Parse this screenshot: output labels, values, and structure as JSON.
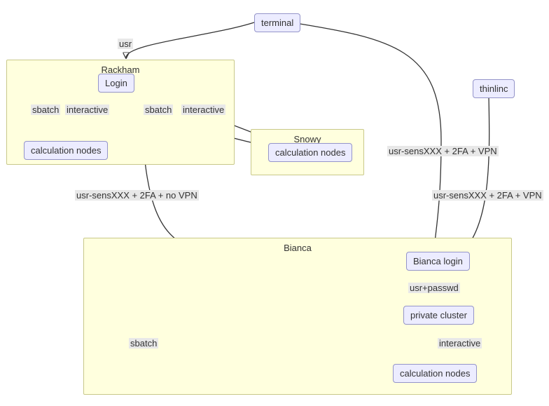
{
  "nodes": {
    "terminal": "terminal",
    "thinlinc": "thinlinc",
    "rackham_login": "Login",
    "rackham_calc": "calculation nodes",
    "snowy_calc": "calculation nodes",
    "bianca_login": "Bianca login",
    "private_cluster": "private cluster",
    "bianca_calc": "calculation nodes"
  },
  "clusters": {
    "rackham": "Rackham",
    "snowy": "Snowy",
    "bianca": "Bianca"
  },
  "edges": {
    "usr": "usr",
    "sbatch1": "sbatch",
    "interactive1": "interactive",
    "sbatch2": "sbatch",
    "interactive2": "interactive",
    "sens_novpn": "usr-sensXXX + 2FA + no VPN",
    "sens_vpn1": "usr-sensXXX + 2FA + VPN",
    "sens_vpn2": "usr-sensXXX + 2FA + VPN",
    "usrpasswd": "usr+passwd",
    "interactive3": "interactive",
    "sbatch3": "sbatch"
  }
}
